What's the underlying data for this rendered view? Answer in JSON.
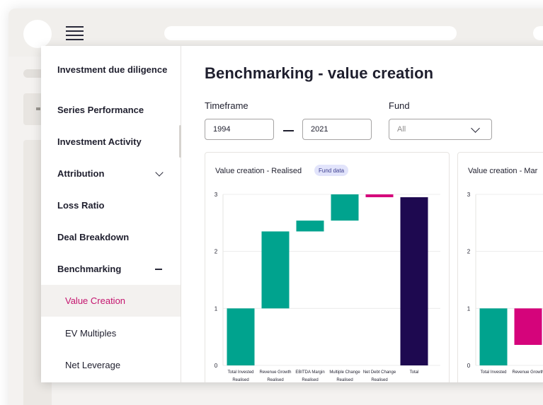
{
  "sidebar": {
    "title": "Investment due diligence",
    "items": [
      {
        "label": "Series Performance"
      },
      {
        "label": "Investment Activity"
      },
      {
        "label": "Attribution"
      },
      {
        "label": "Loss Ratio"
      },
      {
        "label": "Deal Breakdown"
      },
      {
        "label": "Benchmarking"
      },
      {
        "label": "Value Creation"
      },
      {
        "label": "EV Multiples"
      },
      {
        "label": "Net Leverage"
      }
    ]
  },
  "main": {
    "title": "Benchmarking - value creation",
    "timeframe_label": "Timeframe",
    "timeframe_from": "1994",
    "timeframe_to": "2021",
    "fund_label": "Fund",
    "fund_value": "All"
  },
  "colors": {
    "increase": "#00a38e",
    "decrease": "#d5047b",
    "total": "#1e0950",
    "active_nav": "#c4146e",
    "badge_bg": "#e2e4fb"
  },
  "icons": {
    "menu": "hamburger-menu-icon",
    "attribution": "chevron-down-icon",
    "benchmarking": "minus-icon",
    "fund_select": "chevron-down-icon"
  },
  "chart_data": [
    {
      "type": "bar",
      "subtype": "waterfall",
      "title": "Value creation - Realised",
      "badge": "Fund data",
      "ylim": [
        0,
        3
      ],
      "yticks": [
        "0",
        "1",
        "2",
        "3"
      ],
      "categories": [
        "Total Invested Realised",
        "Revenue Growth Realised",
        "EBITDA Margin Realised",
        "Multiple Change Realised",
        "Net Debt Change Realised",
        "Total"
      ],
      "category_lines": [
        [
          "Total Invested",
          "Realised"
        ],
        [
          "Revenue Growth",
          "Realised"
        ],
        [
          "EBITDA Margin",
          "Realised"
        ],
        [
          "Multiple Change",
          "Realised"
        ],
        [
          "Net Debt Change",
          "Realised"
        ],
        [
          "Total"
        ]
      ],
      "bars": [
        {
          "start": 0,
          "end": 1.0,
          "kind": "increase"
        },
        {
          "start": 1.0,
          "end": 2.35,
          "kind": "increase"
        },
        {
          "start": 2.35,
          "end": 2.54,
          "kind": "increase"
        },
        {
          "start": 2.54,
          "end": 3.0,
          "kind": "increase"
        },
        {
          "start": 3.0,
          "end": 2.95,
          "kind": "decrease"
        },
        {
          "start": 0,
          "end": 2.95,
          "kind": "total"
        }
      ],
      "grid": true
    },
    {
      "type": "bar",
      "subtype": "waterfall",
      "title": "Value creation - Mar",
      "ylim": [
        0,
        3
      ],
      "yticks": [
        "0",
        "1",
        "2",
        "3"
      ],
      "categories": [
        "Total Invested",
        "Revenue Growth"
      ],
      "category_lines": [
        [
          "Total Invested"
        ],
        [
          "Revenue Growth"
        ]
      ],
      "bars": [
        {
          "start": 0,
          "end": 1.0,
          "kind": "increase"
        },
        {
          "start": 1.0,
          "end": 0.36,
          "kind": "decrease"
        }
      ],
      "grid": true
    }
  ]
}
